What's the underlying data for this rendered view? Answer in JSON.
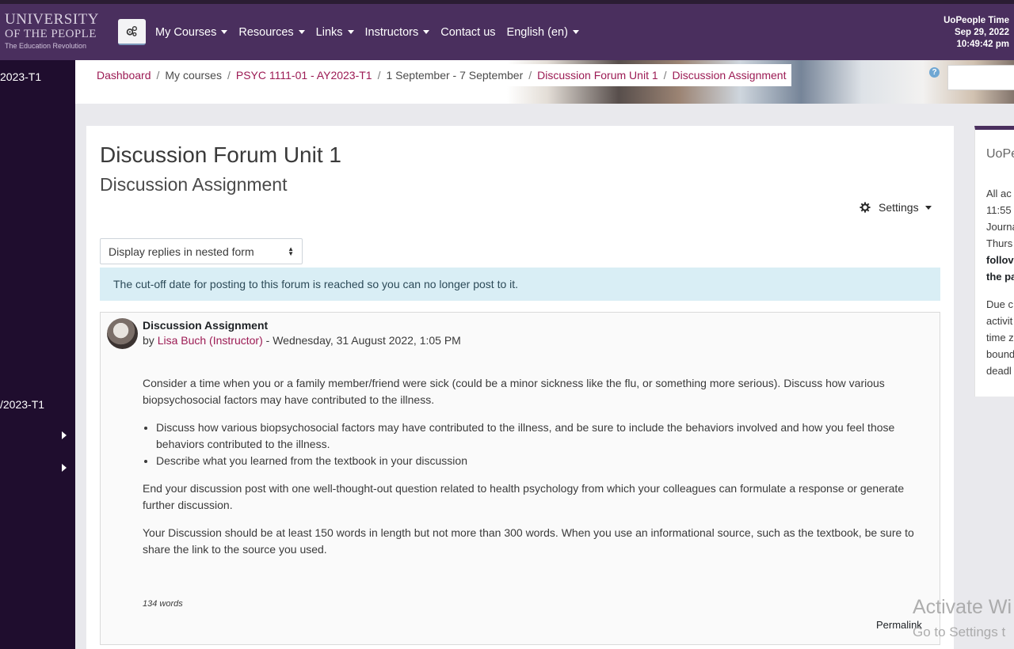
{
  "navbar": {
    "logo": {
      "line1": "UNIVERSITY",
      "line2": "OF THE PEOPLE",
      "tagline": "The Education Revolution"
    },
    "items": [
      {
        "label": "My Courses",
        "dropdown": true
      },
      {
        "label": "Resources",
        "dropdown": true
      },
      {
        "label": "Links",
        "dropdown": true
      },
      {
        "label": "Instructors",
        "dropdown": true
      },
      {
        "label": "Contact us",
        "dropdown": false
      },
      {
        "label": "English (en)",
        "dropdown": true
      }
    ],
    "time": {
      "label": "UoPeople Time",
      "date": "Sep 29, 2022",
      "clock": "10:49:42 pm"
    }
  },
  "drawer": {
    "item1": "2023-T1",
    "item2": "/2023-T1"
  },
  "breadcrumb": [
    {
      "label": "Dashboard",
      "link": true
    },
    {
      "label": "My courses",
      "link": false
    },
    {
      "label": "PSYC 1111-01 - AY2023-T1",
      "link": true
    },
    {
      "label": "1 September - 7 September",
      "link": false
    },
    {
      "label": "Discussion Forum Unit 1",
      "link": true
    },
    {
      "label": "Discussion Assignment",
      "link": true
    }
  ],
  "main": {
    "title": "Discussion Forum Unit 1",
    "subtitle": "Discussion Assignment",
    "settings_label": "Settings",
    "display_mode": "Display replies in nested form",
    "notice": "The cut-off date for posting to this forum is reached so you can no longer post to it."
  },
  "post": {
    "subject": "Discussion Assignment",
    "by": "by",
    "author": "Lisa Buch (Instructor)",
    "date": "- Wednesday, 31 August 2022, 1:05 PM",
    "para1": "Consider a time when you or a family member/friend were sick (could be a minor sickness like the flu, or something more serious). Discuss how various biopsychosocial factors may have contributed to the illness.",
    "bullets": [
      "Discuss how various biopsychosocial factors may have contributed to the illness, and be sure to include the behaviors involved and how you feel those behaviors contributed to the illness.",
      "Describe what you learned from the textbook in your discussion"
    ],
    "para2": "End your discussion post with one well-thought-out question related to health psychology from which your colleagues can formulate a response or generate further discussion.",
    "para3": "Your Discussion should be at least 150 words in length but not more than 300 words. When you use an informational source, such as the textbook, be sure to share the link to the source you used.",
    "wordcount": "134 words",
    "permalink": "Permalink"
  },
  "rightblock": {
    "title": "UoPe",
    "lines": [
      "All ac",
      "11:55",
      "Journa",
      "Thurs",
      "follov",
      "the pa",
      "Due c",
      "activit",
      "time z",
      "bound",
      "deadl"
    ]
  },
  "watermark": {
    "line1": "Activate Wi",
    "line2": "Go to Settings t"
  },
  "colors": {
    "navbar": "#4a2f5e",
    "drawer": "#1f0d2e",
    "link": "#9c1b54",
    "notice": "#d9eef5"
  }
}
